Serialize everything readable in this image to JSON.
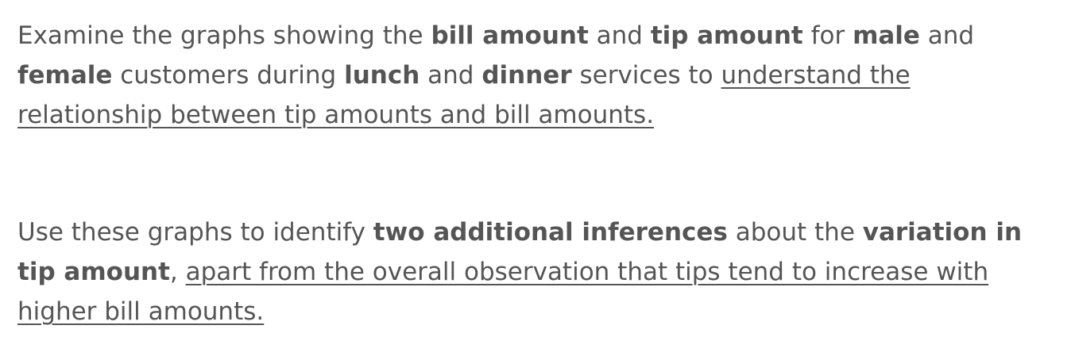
{
  "paragraph_1": {
    "t1": "Examine the graphs showing the ",
    "t2": "bill amount",
    "t3": " and ",
    "t4": "tip amount",
    "t5": " for ",
    "t6": "male",
    "t7": " and ",
    "t8": "female",
    "t9": " customers during ",
    "t10": "lunch",
    "t11": " and ",
    "t12": "dinner",
    "t13": " services to ",
    "t14": "understand the relationship between tip amounts and bill amounts."
  },
  "paragraph_2": {
    "t1": "Use these graphs to identify ",
    "t2": "two additional inferences",
    "t3": " about the ",
    "t4": "variation in tip amount",
    "t5": ", ",
    "t6": "apart from the overall observation that tips tend to increase with higher bill amounts."
  }
}
